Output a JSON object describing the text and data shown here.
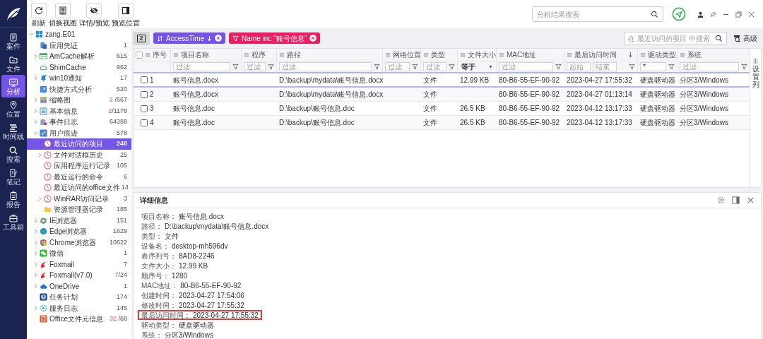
{
  "nav": [
    {
      "kind": "case",
      "label": "案件",
      "selected": false
    },
    {
      "kind": "file",
      "label": "文件",
      "selected": false
    },
    {
      "kind": "analysis",
      "label": "分析",
      "selected": true
    },
    {
      "kind": "location",
      "label": "位置",
      "selected": false
    },
    {
      "kind": "timeline",
      "label": "时间线",
      "selected": false
    },
    {
      "kind": "search",
      "label": "搜索",
      "selected": false
    },
    {
      "kind": "notes",
      "label": "笔记",
      "selected": false
    },
    {
      "kind": "report",
      "label": "报告",
      "selected": false
    },
    {
      "kind": "toolbox",
      "label": "工具箱",
      "selected": false
    }
  ],
  "toolbar": [
    {
      "kind": "refresh",
      "label": "刷新"
    },
    {
      "kind": "view",
      "label": "切换视图"
    },
    {
      "kind": "hide",
      "label": "详情/预览"
    },
    {
      "kind": "panel",
      "label": "预览位置"
    }
  ],
  "global_search": {
    "placeholder": "分析结果搜索"
  },
  "tree": [
    {
      "kind": "windows",
      "label": "zang.E01",
      "expandable": true,
      "expanded": true,
      "selected": false,
      "children": [
        {
          "kind": "credential",
          "label": "应用凭证",
          "count": "1",
          "expandable": false,
          "selected": false
        },
        {
          "kind": "table",
          "label": "AmCache解析",
          "count": "615",
          "expandable": true,
          "expanded": false,
          "selected": false
        },
        {
          "kind": "cache",
          "label": "ShimCache",
          "count": "962",
          "expandable": false,
          "selected": false
        },
        {
          "kind": "bell",
          "label": "win10通知",
          "count": "17",
          "expandable": true,
          "expanded": false,
          "selected": false
        },
        {
          "kind": "shortcut",
          "label": "快捷方式分析",
          "count": "520",
          "expandable": false,
          "selected": false
        },
        {
          "kind": "thumbnails",
          "label": "缩略图",
          "alert": "2",
          "count": " /667",
          "expandable": true,
          "expanded": false,
          "selected": false
        },
        {
          "kind": "list",
          "label": "基本信息",
          "alert": "2",
          "count": "/1178",
          "expandable": true,
          "expanded": false,
          "selected": false
        },
        {
          "kind": "log",
          "label": "事件日志",
          "count": "64388",
          "expandable": true,
          "expanded": false,
          "selected": false
        },
        {
          "kind": "traces",
          "label": "用户痕迹",
          "count": "578",
          "expandable": true,
          "expanded": true,
          "selected": false,
          "children": [
            {
              "kind": "clock",
              "label": "最近访问的项目",
              "count": "240",
              "expandable": false,
              "selected": true
            },
            {
              "kind": "clock",
              "label": "文件对话框历史",
              "count": "25",
              "expandable": true,
              "expanded": false,
              "selected": false
            },
            {
              "kind": "clock",
              "label": "应用程序运行记录",
              "count": "105",
              "expandable": false,
              "selected": false
            },
            {
              "kind": "clock",
              "label": "最近运行的命令",
              "count": "6",
              "expandable": false,
              "selected": false
            },
            {
              "kind": "clock",
              "label": "最近访问的office文件",
              "count": "14",
              "expandable": false,
              "selected": false
            },
            {
              "kind": "clock",
              "label": "WinRAR访问记录",
              "count": "3",
              "expandable": true,
              "expanded": false,
              "selected": false
            },
            {
              "kind": "folder",
              "label": "资源管理器记录",
              "count": "185",
              "expandable": false,
              "selected": false
            }
          ]
        },
        {
          "kind": "ie",
          "label": "IE浏览器",
          "count": "151",
          "expandable": true,
          "expanded": false,
          "selected": false
        },
        {
          "kind": "edge",
          "label": "Edge浏览器",
          "count": "1629",
          "expandable": true,
          "expanded": false,
          "selected": false
        },
        {
          "kind": "chrome",
          "label": "Chrome浏览器",
          "count": "10622",
          "expandable": true,
          "expanded": false,
          "selected": false
        },
        {
          "kind": "chat",
          "label": "微信",
          "count": "1",
          "expandable": true,
          "expanded": false,
          "selected": false
        },
        {
          "kind": "fox",
          "label": "Foxmail",
          "count": "7",
          "expandable": true,
          "expanded": false,
          "selected": false
        },
        {
          "kind": "fox",
          "label": "Foxmail(v7.0)",
          "alert": "7",
          "count": "/24",
          "expandable": true,
          "expanded": false,
          "selected": false
        },
        {
          "kind": "cloud",
          "label": "OneDrive",
          "count": "1",
          "expandable": true,
          "expanded": false,
          "selected": false
        },
        {
          "kind": "calendar",
          "label": "任务计划",
          "count": "174",
          "expandable": false,
          "selected": false
        },
        {
          "kind": "service",
          "label": "服务日志",
          "count": "145",
          "expandable": true,
          "expanded": false,
          "selected": false
        },
        {
          "kind": "office",
          "label": "Office文件元信息",
          "alert": "32",
          "count": " /68",
          "expandable": false,
          "selected": false
        }
      ]
    }
  ],
  "chips_toggle": "2",
  "chips": [
    {
      "kind": "sort",
      "label": "AccessTime",
      "color": "#7353ea"
    },
    {
      "kind": "filter",
      "label": "Name inc \"账号信息\"",
      "color": "#ea1f63"
    }
  ],
  "table_search": {
    "placeholder": "在 最近访问的项目 中搜索"
  },
  "advanced": "高级",
  "table": {
    "header_checked": false,
    "columns": [
      {
        "label": "序号",
        "sorted": false,
        "filter": {
          "kind": "none"
        }
      },
      {
        "label": "项目名称",
        "sorted": false,
        "filter": {
          "kind": "text",
          "placeholder": "过滤"
        }
      },
      {
        "label": "程序",
        "sorted": false,
        "filter": {
          "kind": "text",
          "placeholder": "过滤"
        }
      },
      {
        "label": "路径",
        "sorted": false,
        "filter": {
          "kind": "text",
          "placeholder": "过滤"
        }
      },
      {
        "label": "网络位置",
        "sorted": false,
        "filter": {
          "kind": "text",
          "placeholder": "过滤"
        }
      },
      {
        "label": "类型",
        "sorted": false,
        "filter": {
          "kind": "text",
          "placeholder": "过滤"
        }
      },
      {
        "label": "文件大小",
        "sorted": false,
        "filter": {
          "kind": "select",
          "value": "等于"
        }
      },
      {
        "label": "MAC地址",
        "sorted": false,
        "filter": {
          "kind": "text",
          "placeholder": "过滤"
        }
      },
      {
        "label": "最后访问时间",
        "sorted": true,
        "filter": {
          "kind": "range",
          "fields": [
            {
              "placeholder": "起始"
            },
            {
              "placeholder": "结束"
            }
          ]
        }
      },
      {
        "label": "驱动类型",
        "sorted": false,
        "filter": {
          "kind": "text",
          "value": "*"
        }
      },
      {
        "label": "系统",
        "sorted": false,
        "filter": {
          "kind": "text",
          "placeholder": "过滤"
        }
      }
    ],
    "rows": [
      {
        "selected": true,
        "checked": false,
        "cells": [
          "1",
          "账号信息.docx",
          null,
          "D:\\backup\\mydata\\账号信息.docx",
          null,
          "文件",
          "12.99 KB",
          "80-B6-55-EF-90-92",
          "2023-04-27 17:55:32",
          "硬盘驱动器",
          "分区3/Windows"
        ]
      },
      {
        "selected": false,
        "checked": false,
        "cells": [
          "2",
          "账号信息.docx",
          null,
          "D:\\backup\\mydata\\账号信息.docx",
          null,
          "文件",
          null,
          "80-B6-55-EF-90-92",
          "2023-04-27 01:13:14",
          "硬盘驱动器",
          "分区3/Windows"
        ]
      },
      {
        "selected": false,
        "checked": false,
        "cells": [
          "3",
          "账号信息.doc",
          null,
          "D:\\backup\\账号信息.doc",
          null,
          "文件",
          "26.5 KB",
          "80-B6-55-EF-90-92",
          "2023-04-12 13:17:33",
          "硬盘驱动器",
          "分区3/Windows"
        ]
      },
      {
        "selected": false,
        "checked": false,
        "cells": [
          "4",
          "账号信息.doc",
          null,
          "D:\\backup\\账号信息.doc",
          null,
          "文件",
          "26.5 KB",
          "80-B6-55-EF-90-92",
          "2023-04-12 13:17:33",
          "硬盘驱动器",
          "分区3/Windows"
        ]
      }
    ],
    "column_settings": "设置列"
  },
  "details": {
    "title": "详细信息",
    "fields": [
      {
        "label": "项目名称：",
        "value": "账号信息.docx",
        "highlighted": false
      },
      {
        "label": "路径：",
        "value": "D:\\backup\\mydata\\账号信息.docx",
        "highlighted": false
      },
      {
        "label": "类型：",
        "value": "文件",
        "highlighted": false
      },
      {
        "label": "设备名：",
        "value": "desktop-mh596dv",
        "highlighted": false
      },
      {
        "label": "卷序列号：",
        "value": "8AD8-2246",
        "highlighted": false
      },
      {
        "label": "文件大小：",
        "value": "12.99 KB",
        "highlighted": false
      },
      {
        "label": "顺序号：",
        "value": "1280",
        "highlighted": false
      },
      {
        "label": "MAC地址：",
        "value": "80-B6-55-EF-90-92",
        "highlighted": false
      },
      {
        "label": "创建时间：",
        "value": "2023-04-27 17:54:06",
        "highlighted": false
      },
      {
        "label": "修改时间：",
        "value": "2023-04-27 17:55:32",
        "highlighted": false
      },
      {
        "label": "最后访问时间：",
        "value": "2023-04-27 17:55:32",
        "highlighted": true
      },
      {
        "label": "驱动类型：",
        "value": "硬盘驱动器",
        "highlighted": false
      },
      {
        "label": "系统：",
        "value": "分区3/Windows",
        "highlighted": false
      }
    ]
  }
}
